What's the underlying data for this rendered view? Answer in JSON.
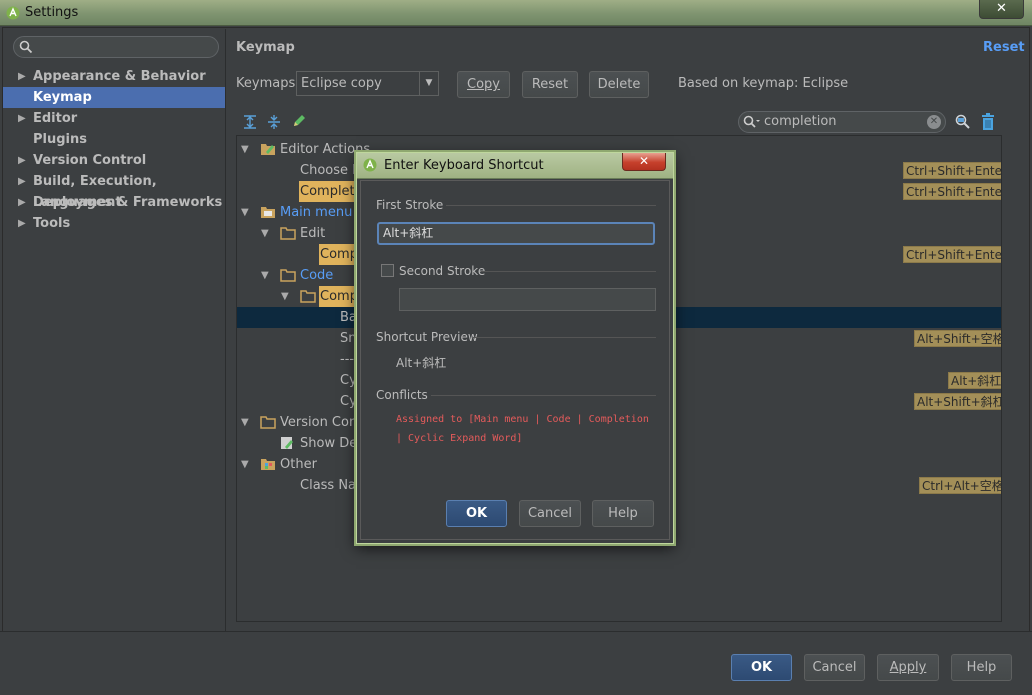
{
  "window": {
    "title": "Settings",
    "close_glyph": "✕"
  },
  "sidebar": {
    "search_placeholder": "",
    "items": [
      {
        "label": "Appearance & Behavior",
        "expandable": true
      },
      {
        "label": "Keymap",
        "expandable": false,
        "selected": true
      },
      {
        "label": "Editor",
        "expandable": true
      },
      {
        "label": "Plugins",
        "expandable": false
      },
      {
        "label": "Version Control",
        "expandable": true
      },
      {
        "label": "Build, Execution, Deployment",
        "expandable": true
      },
      {
        "label": "Languages & Frameworks",
        "expandable": true
      },
      {
        "label": "Tools",
        "expandable": true
      }
    ]
  },
  "keymap": {
    "title": "Keymap",
    "reset_link": "Reset",
    "keymaps_label": "Keymaps:",
    "selected_keymap": "Eclipse copy",
    "copy_button": "Copy",
    "reset_button": "Reset",
    "delete_button": "Delete",
    "based_on": "Based on keymap: Eclipse",
    "filter_value": "completion",
    "tree": [
      {
        "label": "Editor Actions",
        "shortcut": ""
      },
      {
        "label": "Choose L",
        "shortcut": "Ctrl+Shift+Enter"
      },
      {
        "label": "Complete",
        "shortcut": "Ctrl+Shift+Enter"
      },
      {
        "label": "Main menu",
        "shortcut": ""
      },
      {
        "label": "Edit",
        "shortcut": ""
      },
      {
        "label": "Comp",
        "shortcut": "Ctrl+Shift+Enter"
      },
      {
        "label": "Code",
        "shortcut": ""
      },
      {
        "label": "Comp",
        "shortcut": ""
      },
      {
        "label": "Ba",
        "shortcut": ""
      },
      {
        "label": "Sm",
        "shortcut": "Alt+Shift+空格"
      },
      {
        "label": "---",
        "shortcut": ""
      },
      {
        "label": "Cy",
        "shortcut": "Alt+斜杠"
      },
      {
        "label": "Cy",
        "shortcut": "Alt+Shift+斜杠"
      },
      {
        "label": "Version Cont",
        "shortcut": ""
      },
      {
        "label": "Show Det",
        "shortcut": ""
      },
      {
        "label": "Other",
        "shortcut": ""
      },
      {
        "label": "Class Nam",
        "shortcut": "Ctrl+Alt+空格"
      }
    ]
  },
  "dialog": {
    "title": "Enter Keyboard Shortcut",
    "close_glyph": "✕",
    "first_stroke_label": "First Stroke",
    "first_stroke_value": "Alt+斜杠",
    "second_stroke_label": "Second Stroke",
    "second_stroke_value": "",
    "shortcut_preview_label": "Shortcut Preview",
    "shortcut_preview_value": "Alt+斜杠",
    "conflicts_label": "Conflicts",
    "conflict_text": "Assigned to [Main menu | Code | Completion | Cyclic Expand Word]",
    "ok_button": "OK",
    "cancel_button": "Cancel",
    "help_button": "Help"
  },
  "footer": {
    "ok": "OK",
    "cancel": "Cancel",
    "apply": "Apply",
    "help": "Help"
  }
}
